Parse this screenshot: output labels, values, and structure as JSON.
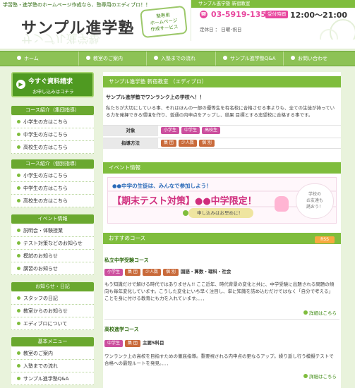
{
  "header": {
    "tagline": "学習塾・進学塾のホームページ作成なら、塾専用のエディブロ！！",
    "site_title": "サンプル進学塾",
    "badge": [
      "塾専用",
      "ホームページ",
      "作成サービス"
    ],
    "contact": {
      "heading": "サンプル進学塾 新宿教室",
      "phone": "03-5919-1356",
      "hours_label": "受付時間",
      "hours": "12:00～21:00",
      "closed": "定休日 ： 日曜･祝日"
    }
  },
  "nav": {
    "items": [
      {
        "label": "ホーム"
      },
      {
        "label": "教室のご案内"
      },
      {
        "label": "入塾までの流れ"
      },
      {
        "label": "サンプル進学塾Q&A"
      },
      {
        "label": "お問い合わせ"
      }
    ]
  },
  "sidebar": {
    "request": {
      "title": "今すぐ資料請求",
      "subtitle": "お申し込みはコチラ"
    },
    "sections": [
      {
        "heading": "コース紹介（集団指導）",
        "items": [
          "小学生の方はこちら",
          "中学生の方はこちら",
          "高校生の方はこちら"
        ]
      },
      {
        "heading": "コース紹介（個別指導）",
        "items": [
          "小学生の方はこちら",
          "中学生の方はこちら",
          "高校生の方はこちら"
        ]
      },
      {
        "heading": "イベント情報",
        "items": [
          "説明会・体験授業",
          "テスト対策などのお知らせ",
          "模試のお知らせ",
          "講習のお知らせ"
        ]
      },
      {
        "heading": "お知らせ・日記",
        "items": [
          "スタッフの日記",
          "教室からのお知らせ",
          "エディブロについて"
        ]
      },
      {
        "heading": "基本メニュー",
        "items": [
          "教室のご案内",
          "入塾までの流れ",
          "サンプル進学塾Q&A"
        ]
      }
    ]
  },
  "main": {
    "intro": {
      "heading": "サンプル進学塾 新宿教室 （エディブロ）",
      "lead": "サンプル進学塾でワンランク上の学校へ！！",
      "body": "私たちが大切にしている事、それはほんの一部の優等生を有名校に合格させる事よりも、全ての生徒が持っている力を発揮できる環境を作り、普通の内申点をアップし、結果 目標とする志望校に合格する事です。",
      "target_label": "対象",
      "targets": [
        "小学生",
        "中学生",
        "高校生"
      ],
      "method_label": "指導方法",
      "methods": [
        "集 団",
        "少人数",
        "個 別"
      ]
    },
    "event": {
      "heading": "イベント情報",
      "line1": "●●中学の生徒は、みんなで参加しよう！",
      "line2": "【期末テスト対策】●●中学限定！",
      "apply": "申し込みはお早めに！",
      "side": [
        "学校の",
        "お友達も",
        "誘おう！"
      ]
    },
    "courses": {
      "heading": "おすすめコース",
      "rss": "RSS",
      "list": [
        {
          "title": "私立中学受験コース",
          "tags": [
            {
              "text": "小学生",
              "kind": "pink"
            },
            {
              "text": "集 団",
              "kind": "brown"
            },
            {
              "text": "少人数",
              "kind": "brown"
            },
            {
              "text": "個 別",
              "kind": "brown"
            }
          ],
          "subjects": "国語・算数・理科・社会",
          "body": "もう知識だけで解ける時代ではありません!! ここ近年、時代背景の変化と共に、中学受験に出題される問題の傾向も毎年変化しています。こうした変化にいち早く注目し、単に知識を詰め込むだけではなく「自分で考える」ことを身に付ける教育にも力を入れています。．．．",
          "more": "詳細はこちら"
        },
        {
          "title": "高校進学コース",
          "tags": [
            {
              "text": "中学生",
              "kind": "pink"
            },
            {
              "text": "集 団",
              "kind": "brown"
            }
          ],
          "subjects": "主要5科目",
          "body": "ワンランク上の高校を目指すための徹底指導。重要視される内申点の更なるアップ。繰り返し行う模擬テストで合格への最短ルートを発見。．．．",
          "more": "詳細はこちら"
        }
      ]
    }
  },
  "colors": {
    "accent_green": "#7fbd3d",
    "nav_green": "#8dc255",
    "pink": "#e8479e",
    "tag_pink": "#cc4f9e",
    "tag_brown": "#c96a3a"
  }
}
